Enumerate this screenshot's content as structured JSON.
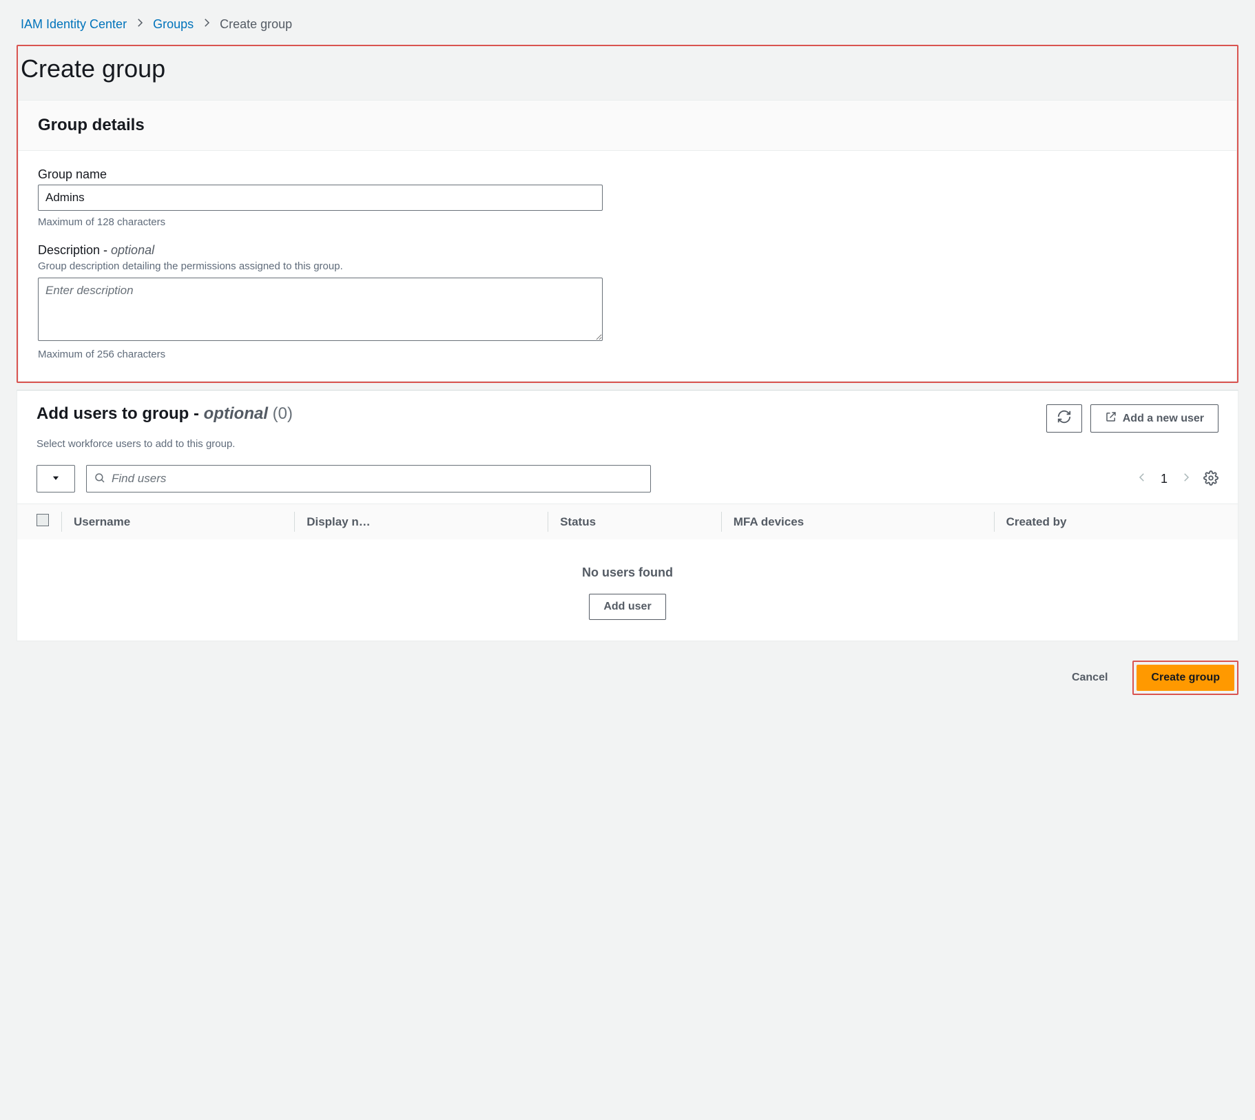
{
  "breadcrumb": {
    "items": [
      {
        "label": "IAM Identity Center"
      },
      {
        "label": "Groups"
      }
    ],
    "current": "Create group"
  },
  "page": {
    "title": "Create group"
  },
  "group_details": {
    "panel_title": "Group details",
    "name_label": "Group name",
    "name_value": "Admins",
    "name_hint": "Maximum of 128 characters",
    "desc_label": "Description - ",
    "desc_optional": "optional",
    "desc_help": "Group description detailing the permissions assigned to this group.",
    "desc_placeholder": "Enter description",
    "desc_hint": "Maximum of 256 characters"
  },
  "add_users": {
    "title": "Add users to group - ",
    "optional": "optional",
    "count": "(0)",
    "subtitle": "Select workforce users to add to this group.",
    "refresh_aria": "Refresh",
    "add_new_user": "Add a new user",
    "search_placeholder": "Find users",
    "page_number": "1",
    "columns": {
      "c1": "Username",
      "c2": "Display n…",
      "c3": "Status",
      "c4": "MFA devices",
      "c5": "Created by"
    },
    "empty_msg": "No users found",
    "add_user_btn": "Add user"
  },
  "footer": {
    "cancel": "Cancel",
    "create": "Create group"
  }
}
